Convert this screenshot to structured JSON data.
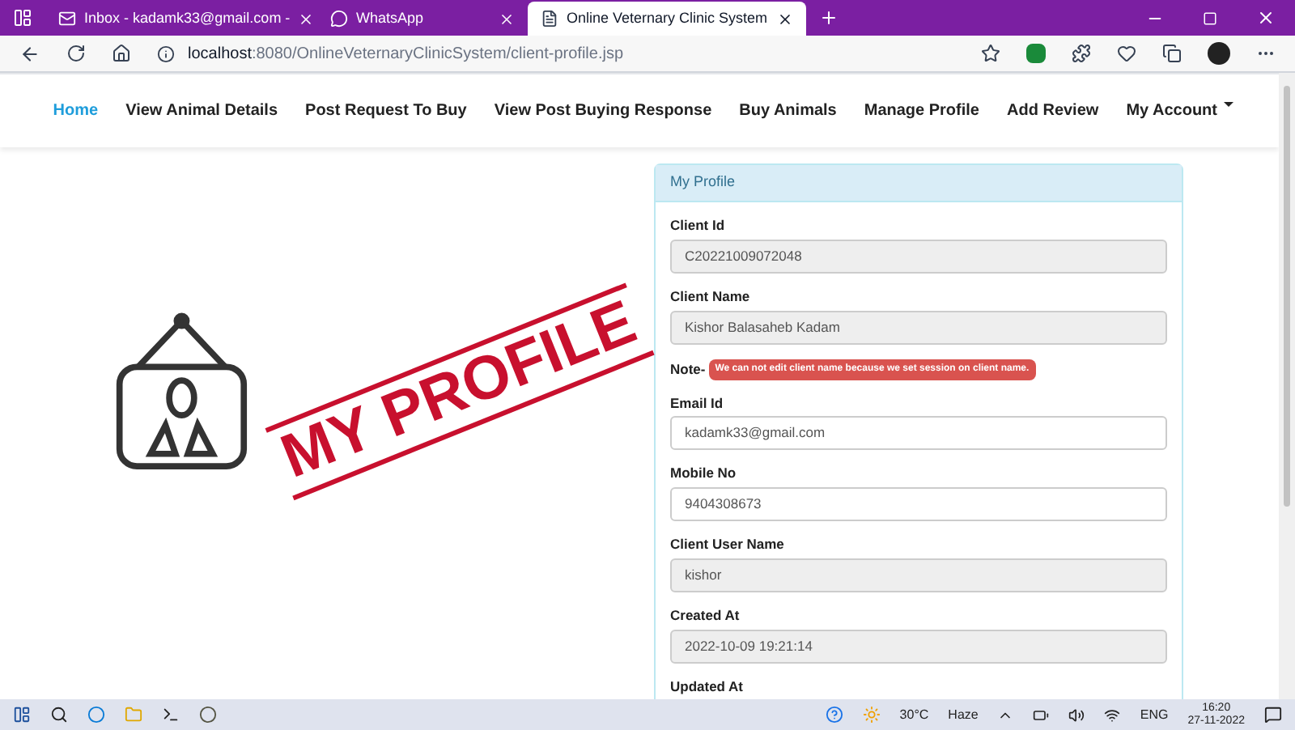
{
  "browser": {
    "tabs": [
      {
        "label": "Inbox - kadamk33@gmail.com -",
        "selected": false
      },
      {
        "label": "WhatsApp",
        "selected": false
      },
      {
        "label": "Online Veternary Clinic System",
        "selected": true
      }
    ],
    "address": {
      "host": "localhost",
      "path": ":8080/OnlineVeternaryClinicSystem/client-profile.jsp"
    }
  },
  "nav": {
    "items": [
      {
        "label": "Home",
        "selected": true,
        "dropdown": false
      },
      {
        "label": "View Animal Details",
        "selected": false,
        "dropdown": false
      },
      {
        "label": "Post Request To Buy",
        "selected": false,
        "dropdown": false
      },
      {
        "label": "View Post Buying Response",
        "selected": false,
        "dropdown": false
      },
      {
        "label": "Buy Animals",
        "selected": false,
        "dropdown": false
      },
      {
        "label": "Manage Profile",
        "selected": false,
        "dropdown": false
      },
      {
        "label": "Add Review",
        "selected": false,
        "dropdown": false
      },
      {
        "label": "My Account",
        "selected": false,
        "dropdown": true
      }
    ]
  },
  "illustration": {
    "stamp_text": "MY PROFILE"
  },
  "profile": {
    "title": "My Profile",
    "fields": [
      {
        "kind": "field",
        "label": "Client Id",
        "value": "C20221009072048",
        "readonly": true
      },
      {
        "kind": "field",
        "label": "Client Name",
        "value": "Kishor Balasaheb Kadam",
        "readonly": true
      },
      {
        "kind": "note",
        "label": "Note-",
        "value": "We can not edit client name because we set session on client name."
      },
      {
        "kind": "field",
        "label": "Email Id",
        "value": "kadamk33@gmail.com",
        "readonly": false
      },
      {
        "kind": "field",
        "label": "Mobile No",
        "value": "9404308673",
        "readonly": false
      },
      {
        "kind": "field",
        "label": "Client User Name",
        "value": "kishor",
        "readonly": true
      },
      {
        "kind": "field",
        "label": "Created At",
        "value": "2022-10-09 19:21:14",
        "readonly": true
      },
      {
        "kind": "label",
        "label": "Updated At"
      }
    ]
  },
  "taskbar": {
    "temperature": "30°C",
    "weather": "Haze",
    "language": "ENG",
    "time": "16:20",
    "date": "27-11-2022"
  }
}
